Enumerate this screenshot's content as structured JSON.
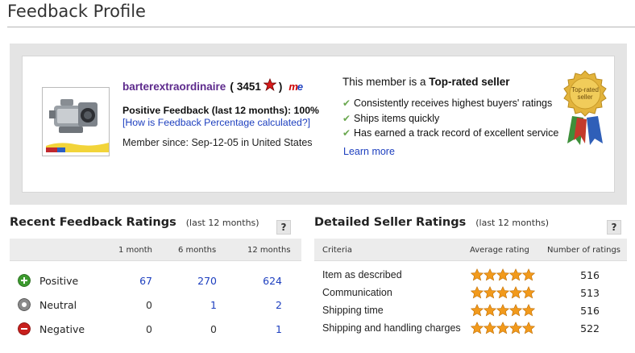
{
  "page_title": "Feedback Profile",
  "member": {
    "name": "barterextraordinaire",
    "paren_open": "(",
    "score": "3451",
    "paren_close": ")",
    "me_badge_m": "m",
    "me_badge_e": "e",
    "positive_feedback": "Positive Feedback (last 12 months): 100%",
    "pf_link": "[How is Feedback Percentage calculated?]",
    "member_since": "Member since: Sep-12-05 in United States"
  },
  "top_rated": {
    "heading_prefix": "This member is a ",
    "heading_bold": "Top-rated seller",
    "points": [
      "Consistently receives highest buyers' ratings",
      "Ships items quickly",
      "Has earned a track record of excellent service"
    ],
    "learn_more": "Learn more",
    "seal_line1": "Top-rated",
    "seal_line2": "seller"
  },
  "recent_feedback": {
    "title": "Recent Feedback Ratings",
    "subtitle": "(last 12 months)",
    "help": "?",
    "columns": [
      "1 month",
      "6 months",
      "12 months"
    ],
    "rows": [
      {
        "label": "Positive",
        "icon": "plus-circle-icon",
        "color": "#3c9a2e",
        "values": [
          "67",
          "270",
          "624"
        ]
      },
      {
        "label": "Neutral",
        "icon": "neutral-circle-icon",
        "color": "#8a8a8a",
        "values": [
          "0",
          "1",
          "2"
        ]
      },
      {
        "label": "Negative",
        "icon": "minus-circle-icon",
        "color": "#c8201d",
        "values": [
          "0",
          "0",
          "1"
        ]
      }
    ]
  },
  "detailed_ratings": {
    "title": "Detailed Seller Ratings",
    "subtitle": "(last 12 months)",
    "help": "?",
    "columns": [
      "Criteria",
      "Average rating",
      "Number of ratings"
    ],
    "rows": [
      {
        "criteria": "Item as described",
        "stars": 5,
        "count": "516"
      },
      {
        "criteria": "Communication",
        "stars": 5,
        "count": "513"
      },
      {
        "criteria": "Shipping time",
        "stars": 5,
        "count": "516"
      },
      {
        "criteria": "Shipping and handling charges",
        "stars": 5,
        "count": "522"
      }
    ]
  },
  "colors": {
    "link": "#1d3fbf",
    "member_name": "#5d2a8c",
    "star": "#f29a1c",
    "panel_bg": "#e4e4e4"
  }
}
